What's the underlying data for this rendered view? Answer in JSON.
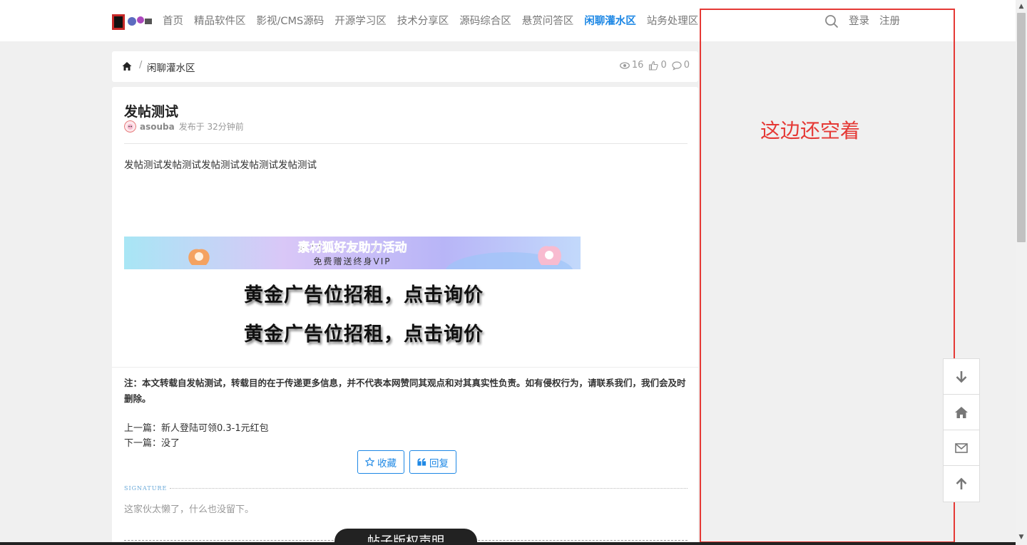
{
  "header": {
    "nav": [
      "首页",
      "精品软件区",
      "影视/CMS源码",
      "开源学习区",
      "技术分享区",
      "源码综合区",
      "悬赏问答区",
      "闲聊灌水区",
      "站务处理区"
    ],
    "active_nav": "闲聊灌水区",
    "login": "登录",
    "register": "注册"
  },
  "breadcrumb": {
    "separator": "/",
    "current": "闲聊灌水区",
    "views": "16",
    "likes": "0",
    "comments": "0"
  },
  "post": {
    "title": "发帖测试",
    "author": "asouba",
    "time": "发布于 32分钟前",
    "body": "发帖测试发帖测试发帖测试发帖测试发帖测试",
    "banner_title": "素材狐好友助力活动",
    "banner_sub": "免费赠送终身VIP",
    "ad1": "黄金广告位招租，点击询价",
    "ad2": "黄金广告位招租，点击询价",
    "notice": "注：本文转载自发帖测试，转载目的在于传递更多信息，并不代表本网赞同其观点和对其真实性负责。如有侵权行为，请联系我们，我们会及时删除。",
    "prev": "上一篇：新人登陆可领0.3-1元红包",
    "next": "下一篇：没了",
    "favorite": "收藏",
    "reply": "回复",
    "signature_label": "SIGNATURE",
    "signature_text": "这家伙太懒了，什么也没留下。",
    "copyright": "帖子版权声明"
  },
  "annotation": {
    "text": "这边还空着",
    "color": "#e53935"
  },
  "colors": {
    "accent": "#1e88e5",
    "background": "#f0f0f0"
  },
  "icons": [
    "search-icon",
    "home-icon",
    "eye-icon",
    "thumbs-up-icon",
    "comment-icon",
    "star-icon",
    "quote-icon",
    "arrow-down-icon",
    "home-tool-icon",
    "mail-icon",
    "arrow-up-icon"
  ]
}
